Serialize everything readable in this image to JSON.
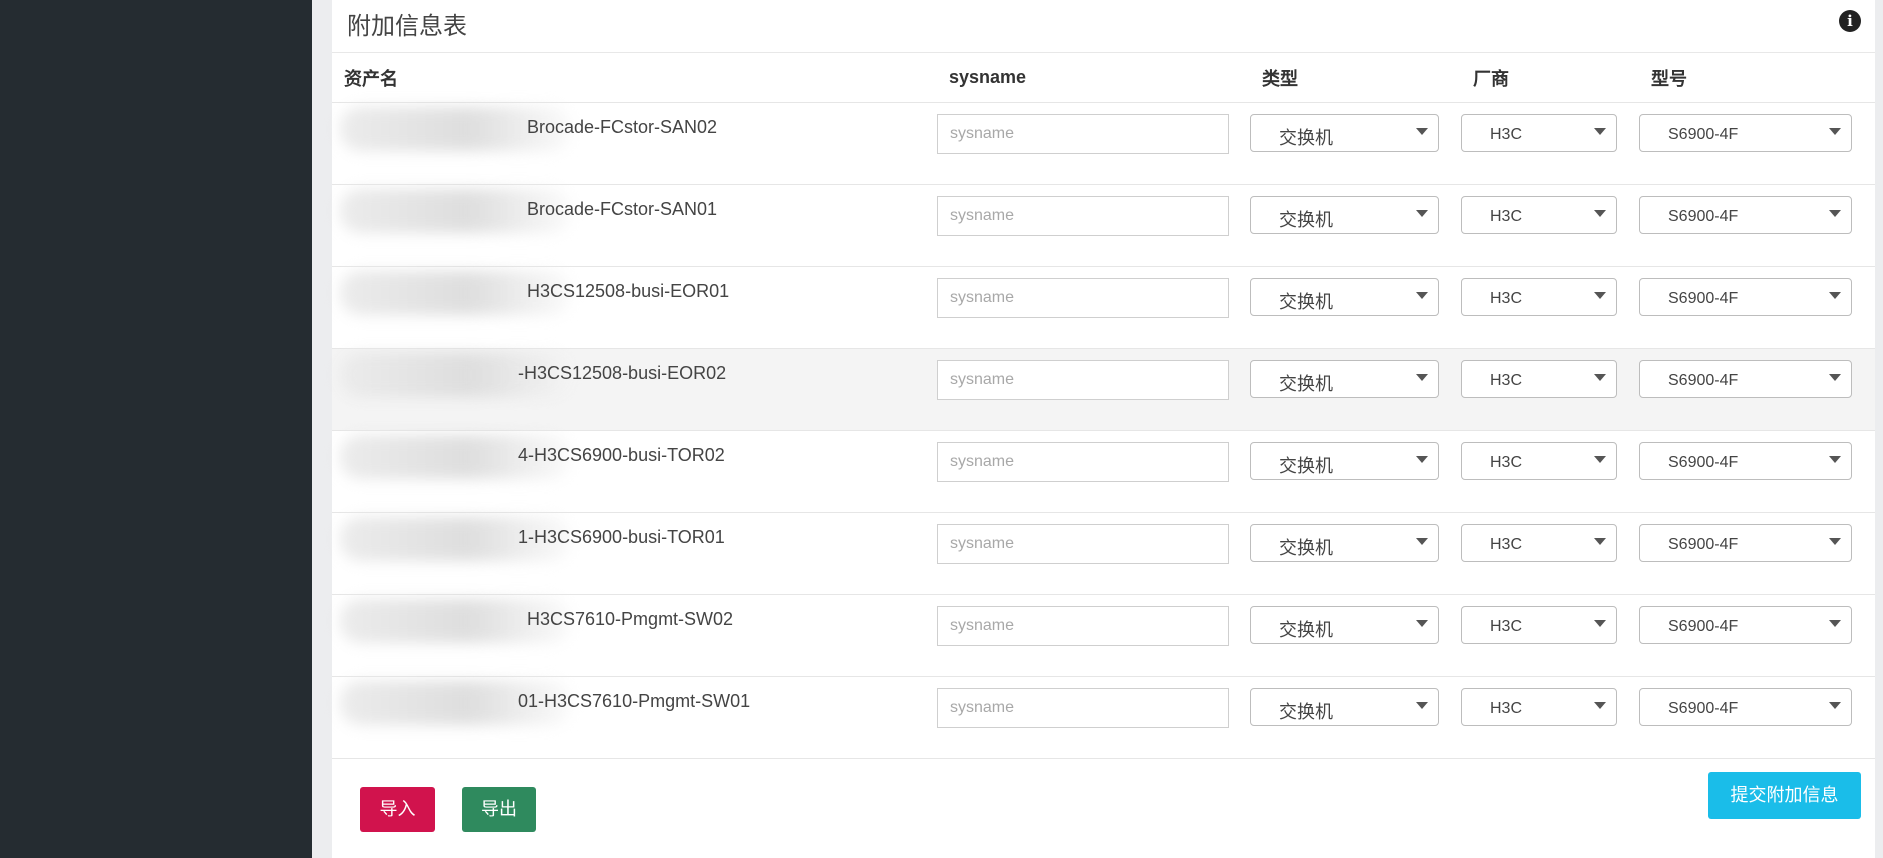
{
  "panel": {
    "title": "附加信息表",
    "info_icon": "info-circle-icon"
  },
  "table": {
    "headers": {
      "asset": "资产名",
      "sysname": "sysname",
      "type": "类型",
      "vendor": "厂商",
      "model": "型号"
    },
    "rows": [
      {
        "asset_visible": "Brocade-FCstor-SAN02",
        "sysname_placeholder": "sysname",
        "type": "交换机",
        "vendor": "H3C",
        "model": "S6900-4F"
      },
      {
        "asset_visible": "Brocade-FCstor-SAN01",
        "sysname_placeholder": "sysname",
        "type": "交换机",
        "vendor": "H3C",
        "model": "S6900-4F"
      },
      {
        "asset_visible": "H3CS12508-busi-EOR01",
        "sysname_placeholder": "sysname",
        "type": "交换机",
        "vendor": "H3C",
        "model": "S6900-4F"
      },
      {
        "asset_visible": "-H3CS12508-busi-EOR02",
        "sysname_placeholder": "sysname",
        "type": "交换机",
        "vendor": "H3C",
        "model": "S6900-4F"
      },
      {
        "asset_visible": "4-H3CS6900-busi-TOR02",
        "sysname_placeholder": "sysname",
        "type": "交换机",
        "vendor": "H3C",
        "model": "S6900-4F"
      },
      {
        "asset_visible": "1-H3CS6900-busi-TOR01",
        "sysname_placeholder": "sysname",
        "type": "交换机",
        "vendor": "H3C",
        "model": "S6900-4F"
      },
      {
        "asset_visible": "H3CS7610-Pmgmt-SW02",
        "sysname_placeholder": "sysname",
        "type": "交换机",
        "vendor": "H3C",
        "model": "S6900-4F"
      },
      {
        "asset_visible": "01-H3CS7610-Pmgmt-SW01",
        "sysname_placeholder": "sysname",
        "type": "交换机",
        "vendor": "H3C",
        "model": "S6900-4F"
      }
    ]
  },
  "buttons": {
    "import": "导入",
    "export": "导出",
    "submit": "提交附加信息"
  },
  "colors": {
    "sidebar": "#252c31",
    "import_button": "#d1134d",
    "export_button": "#2f8a5e",
    "submit_button": "#1abde9"
  }
}
